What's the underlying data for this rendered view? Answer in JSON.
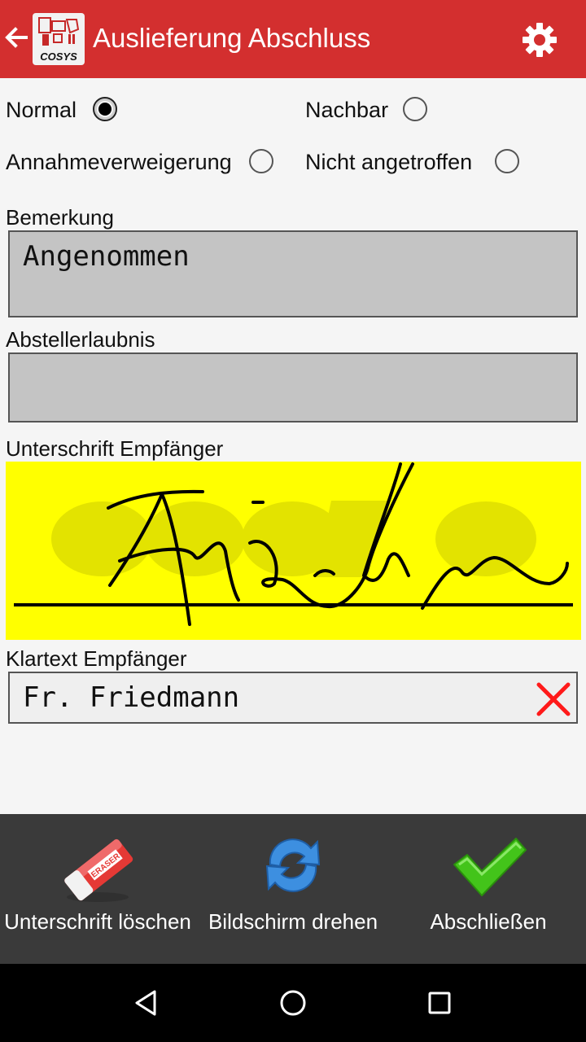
{
  "header": {
    "title": "Auslieferung Abschluss",
    "logo_text": "COSYS",
    "accent_color": "#d32f2f",
    "back_icon": "arrow-back-icon",
    "settings_icon": "gear-icon"
  },
  "status_options": [
    {
      "label": "Normal",
      "checked": true
    },
    {
      "label": "Nachbar",
      "checked": false
    },
    {
      "label": "Annahmeverweigerung",
      "checked": false
    },
    {
      "label": "Nicht angetroffen",
      "checked": false
    }
  ],
  "fields": {
    "bemerkung": {
      "label": "Bemerkung",
      "value": "Angenommen"
    },
    "abstellerlaubnis": {
      "label": "Abstellerlaubnis",
      "value": ""
    },
    "signature": {
      "label": "Unterschrift Empfänger",
      "pad_color": "#ffff00"
    },
    "klartext": {
      "label": "Klartext Empfänger",
      "value": "Fr. Friedmann",
      "clear_icon": "red-x-icon"
    }
  },
  "actions": {
    "clear_signature": {
      "label": "Unterschrift löschen",
      "icon": "eraser-icon"
    },
    "rotate_screen": {
      "label": "Bildschirm drehen",
      "icon": "refresh-icon"
    },
    "finish": {
      "label": "Abschließen",
      "icon": "checkmark-icon"
    }
  },
  "navigation": {
    "back": "back-triangle-icon",
    "home": "home-circle-icon",
    "recents": "recents-square-icon"
  }
}
